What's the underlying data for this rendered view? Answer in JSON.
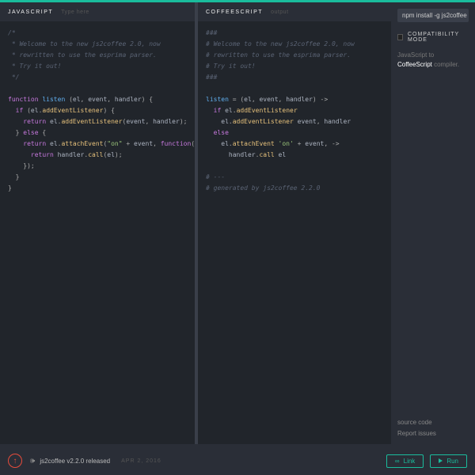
{
  "left": {
    "title": "JAVASCRIPT",
    "hint": "Type here",
    "code_html": "<span class=\"cm-comment\">/*\n * Welcome to the new js2coffee 2.0, now\n * rewritten to use the esprima parser.\n * Try it out!\n */</span>\n\n<span class=\"cm-keyword\">function</span> <span class=\"cm-def\">listen</span> (<span class=\"cm-var\">el</span>, <span class=\"cm-var\">event</span>, <span class=\"cm-var\">handler</span>) {\n  <span class=\"cm-keyword\">if</span> (<span class=\"cm-var\">el</span>.<span class=\"cm-prop\">addEventListener</span>) {\n    <span class=\"cm-keyword\">return</span> <span class=\"cm-var\">el</span>.<span class=\"cm-prop\">addEventListener</span>(<span class=\"cm-var\">event</span>, <span class=\"cm-var\">handler</span>);\n  } <span class=\"cm-keyword\">else</span> {\n    <span class=\"cm-keyword\">return</span> <span class=\"cm-var\">el</span>.<span class=\"cm-prop\">attachEvent</span>(<span class=\"cm-str\">\"on\"</span> + <span class=\"cm-var\">event</span>, <span class=\"cm-keyword\">function</span>()\n      <span class=\"cm-keyword\">return</span> <span class=\"cm-var\">handler</span>.<span class=\"cm-prop\">call</span>(<span class=\"cm-var\">el</span>);\n    });\n  }\n}"
  },
  "right": {
    "title": "COFFEESCRIPT",
    "hint": "output",
    "code_html": "<span class=\"cm-comment\">###\n# Welcome to the new js2coffee 2.0, now\n# rewritten to use the esprima parser.\n# Try it out!\n###</span>\n\n<span class=\"cm-def\">listen</span> = (<span class=\"cm-var\">el</span>, <span class=\"cm-var\">event</span>, <span class=\"cm-var\">handler</span>) -&gt;\n  <span class=\"cm-keyword\">if</span> <span class=\"cm-var\">el</span>.<span class=\"cm-prop\">addEventListener</span>\n    <span class=\"cm-var\">el</span>.<span class=\"cm-prop\">addEventListener</span> <span class=\"cm-var\">event</span>, <span class=\"cm-var\">handler</span>\n  <span class=\"cm-keyword\">else</span>\n    <span class=\"cm-var\">el</span>.<span class=\"cm-prop\">attachEvent</span> <span class=\"cm-str\">'on'</span> + <span class=\"cm-var\">event</span>, -&gt;\n      <span class=\"cm-var\">handler</span>.<span class=\"cm-prop\">call</span> <span class=\"cm-var\">el</span>\n\n<span class=\"cm-comment\"># ---\n# generated by js2coffee 2.2.0</span>"
  },
  "side": {
    "npm": "npm install -g js2coffee",
    "compat": "COMPATIBILITY MODE",
    "desc_a": "JavaScript to ",
    "desc_b": "CoffeeScript",
    "desc_c": " compiler.",
    "source": "source code",
    "issues": "Report issues"
  },
  "footer": {
    "arrow": "↑",
    "megaphone": "🕪",
    "news": "js2coffee v2.2.0 released",
    "date": "APR 2, 2016",
    "link": "Link",
    "run": "Run"
  }
}
